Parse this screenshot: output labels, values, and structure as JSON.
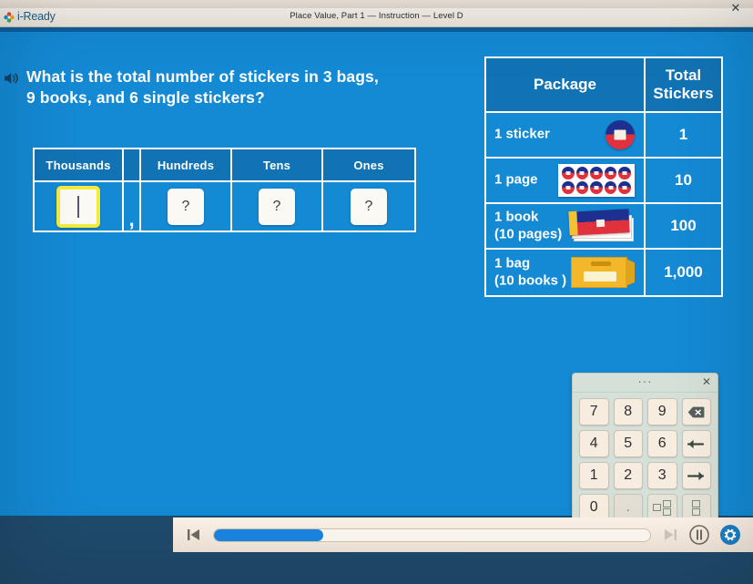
{
  "window": {
    "close_label": "✕"
  },
  "header": {
    "brand": "i-Ready",
    "title": "Place Value, Part 1 — Instruction — Level D"
  },
  "question": {
    "line1": "What is the total number of stickers in 3 bags,",
    "line2": "9 books, and 6 single stickers?",
    "audio_icon": "speaker-icon"
  },
  "place_value_table": {
    "headers": [
      "Thousands",
      "",
      "Hundreds",
      "Tens",
      "Ones"
    ],
    "cells": [
      {
        "value": "",
        "state": "active",
        "placeholder": ""
      },
      {
        "value": ",",
        "state": "separator"
      },
      {
        "value": "?",
        "state": "empty"
      },
      {
        "value": "?",
        "state": "empty"
      },
      {
        "value": "?",
        "state": "empty"
      }
    ]
  },
  "package_table": {
    "header": {
      "col1": "Package",
      "col2_line1": "Total",
      "col2_line2": "Stickers"
    },
    "rows": [
      {
        "label_line1": "1 sticker",
        "label_line2": "",
        "art": "single-sticker-icon",
        "total": "1"
      },
      {
        "label_line1": "1 page",
        "label_line2": "",
        "art": "page-of-stickers-icon",
        "total": "10"
      },
      {
        "label_line1": "1 book",
        "label_line2": "(10 pages)",
        "art": "book-icon",
        "total": "100"
      },
      {
        "label_line1": "1 bag",
        "label_line2": "(10 books )",
        "art": "bag-icon",
        "total": "1,000"
      }
    ]
  },
  "keypad": {
    "menu_label": "···",
    "close_label": "✕",
    "keys": [
      {
        "label": "7",
        "name": "key-7"
      },
      {
        "label": "8",
        "name": "key-8"
      },
      {
        "label": "9",
        "name": "key-9"
      },
      {
        "label": "⌫",
        "name": "key-backspace"
      },
      {
        "label": "4",
        "name": "key-4"
      },
      {
        "label": "5",
        "name": "key-5"
      },
      {
        "label": "6",
        "name": "key-6"
      },
      {
        "label": "←",
        "name": "key-arrow-left"
      },
      {
        "label": "1",
        "name": "key-1"
      },
      {
        "label": "2",
        "name": "key-2"
      },
      {
        "label": "3",
        "name": "key-3"
      },
      {
        "label": "→",
        "name": "key-arrow-right"
      },
      {
        "label": "0",
        "name": "key-0"
      },
      {
        "label": ".",
        "name": "key-decimal"
      },
      {
        "label": "",
        "name": "key-mixed-number"
      },
      {
        "label": "",
        "name": "key-fraction"
      }
    ]
  },
  "bottom_bar": {
    "prev_label": "⏮",
    "next_label": "⏭",
    "pause_label": "⏸",
    "settings_label": "⚙",
    "progress_percent": 25
  },
  "colors": {
    "stage_blue": "#1489d4",
    "table_header_blue": "#1273b4",
    "active_outline_yellow": "#f2ea3c",
    "progress_blue": "#1a85e0",
    "brand_blue": "#16618f"
  }
}
